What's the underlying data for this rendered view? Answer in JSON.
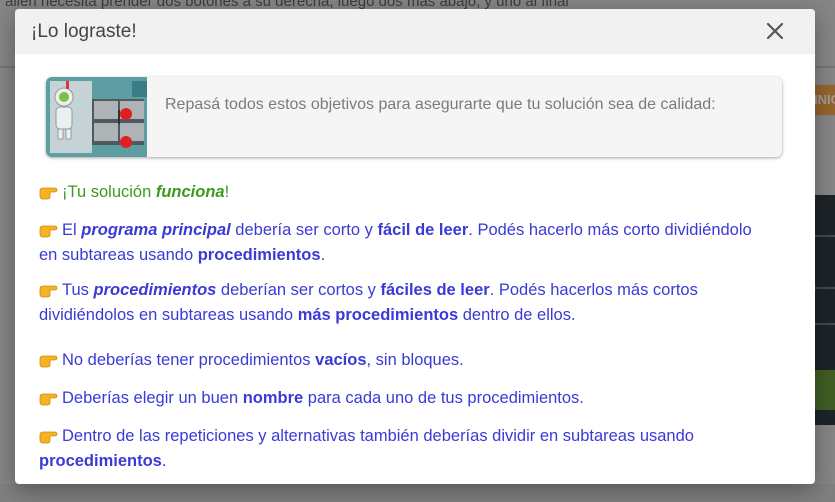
{
  "background": {
    "instruction_text": "alien necesita prender dos botones a su derecha, luego dos más abajo, y uno al final",
    "side_button_label": "INIC"
  },
  "modal": {
    "title": "¡Lo lograste!",
    "close_icon": "close-icon",
    "goal_card": {
      "text": "Repasá todos estos objetivos para asegurarte que tu solución sea de calidad:"
    },
    "checks": [
      {
        "status": "ok",
        "parts": [
          "¡Tu solución ",
          "funciona",
          "!"
        ]
      },
      {
        "status": "pending",
        "parts": [
          "El ",
          "programa principal",
          " debería ser corto y ",
          "fácil de leer",
          ". Podés hacerlo más corto dividiéndolo",
          "en subtareas usando ",
          "procedimientos",
          "."
        ]
      },
      {
        "status": "pending",
        "parts": [
          "Tus ",
          "procedimientos",
          " deberían ser cortos y ",
          "fáciles de leer",
          ". Podés hacerlos más cortos",
          "dividiéndolos en subtareas usando ",
          "más procedimientos",
          " dentro de ellos."
        ]
      },
      {
        "status": "pending",
        "parts": [
          "No deberías tener procedimientos ",
          "vacíos",
          ", sin bloques."
        ]
      },
      {
        "status": "pending",
        "parts": [
          "Deberías elegir un buen ",
          "nombre",
          " para cada uno de tus procedimientos."
        ]
      },
      {
        "status": "pending",
        "parts": [
          "Dentro de las repeticiones y alternativas también deberías dividir en subtareas usando",
          "procedimientos",
          "."
        ]
      }
    ],
    "bullet_icon": "pointing-hand-icon"
  },
  "colors": {
    "ok_text": "#3c9a1c",
    "pending_text": "#3a3ad6",
    "header_bg": "#f1f1f1"
  }
}
